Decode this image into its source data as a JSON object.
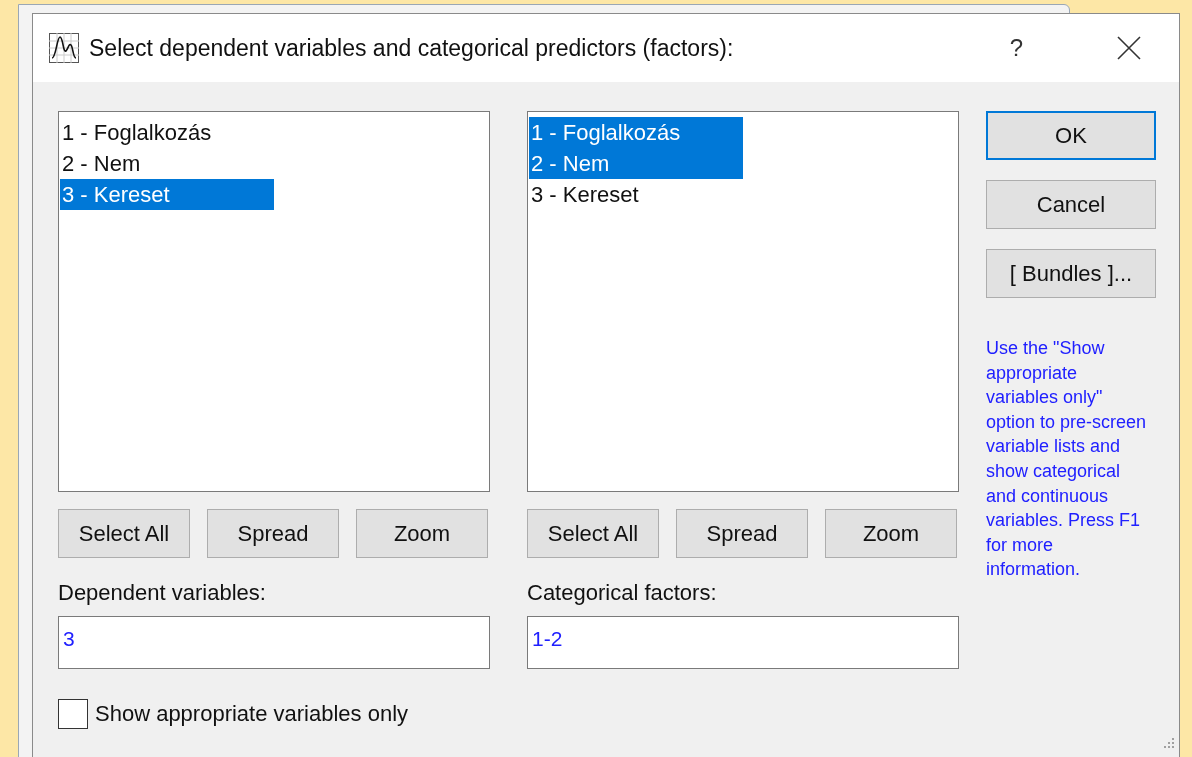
{
  "window": {
    "title": "Select dependent variables and categorical predictors (factors):",
    "help_button": "?"
  },
  "lists": [
    {
      "items": [
        {
          "label": "1 - Foglalkozás",
          "selected": false
        },
        {
          "label": "2 - Nem",
          "selected": false
        },
        {
          "label": "3 - Kereset",
          "selected": true
        }
      ],
      "buttons": [
        "Select All",
        "Spread",
        "Zoom"
      ],
      "field_label": "Dependent variables:",
      "field_value": "3"
    },
    {
      "items": [
        {
          "label": "1 - Foglalkozás",
          "selected": true
        },
        {
          "label": "2 - Nem",
          "selected": true
        },
        {
          "label": "3 - Kereset",
          "selected": false
        }
      ],
      "buttons": [
        "Select All",
        "Spread",
        "Zoom"
      ],
      "field_label": "Categorical factors:",
      "field_value": "1-2"
    }
  ],
  "side_buttons": [
    {
      "label": "OK",
      "default": true
    },
    {
      "label": "Cancel",
      "default": false
    },
    {
      "label": "[ Bundles ]...",
      "default": false
    }
  ],
  "help_text": "Use the \"Show appropriate variables only\" option to pre-screen variable lists and show categorical and continuous variables. Press F1 for more information.",
  "checkbox": {
    "label": "Show appropriate variables only",
    "checked": false
  }
}
